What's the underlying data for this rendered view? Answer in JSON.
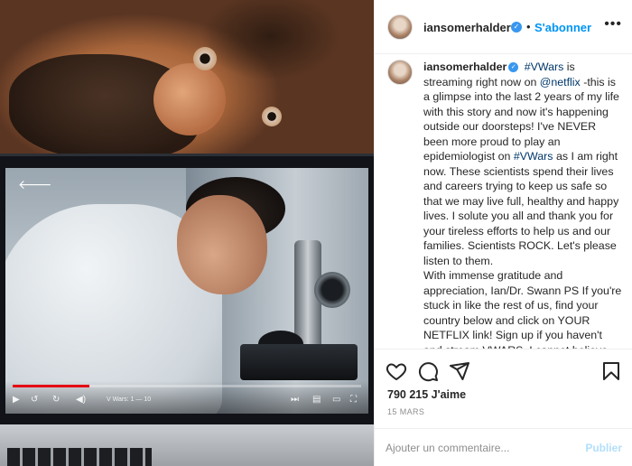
{
  "post": {
    "username": "iansomerhalder",
    "follow_label": "S'abonner",
    "separator": "•",
    "more_label": "•••",
    "verified_mark": "✓"
  },
  "caption": {
    "username": "iansomerhalder",
    "parts": [
      {
        "text": "#VWars",
        "link": true
      },
      {
        "text": " is streaming right now on ",
        "link": false
      },
      {
        "text": "@netflix",
        "link": true
      },
      {
        "text": " -this is a glimpse into the last 2 years of my life with this story and now it's happening outside our doorsteps! I've NEVER been more proud to play an epidemiologist on ",
        "link": false
      },
      {
        "text": "#VWars",
        "link": true
      },
      {
        "text": " as I am right now. These scientists spend their lives and careers trying to keep us safe so that we may live full, healthy and happy lives. I solute you all and thank you for your tireless efforts to help us and our families. Scientists ROCK. Let's please listen to them.",
        "link": false
      }
    ],
    "continuation": "With immense gratitude and appreciation, Ian/Dr. Swann PS If you're stuck in like the rest of us, find your country below and click on YOUR NETFLIX link! Sign up if you haven't and stream VWARS. I cannot believe this is happening to the world! I spent"
  },
  "stats": {
    "likes": "790 215 J'aime",
    "date": "15 MARS"
  },
  "comment": {
    "placeholder": "Ajouter un commentaire...",
    "publish_label": "Publier"
  },
  "video": {
    "title": "V Wars: 1 — 10",
    "progress": 0.22,
    "back_arrow": "🡐"
  },
  "icons": {
    "like": "heart-icon",
    "comment": "comment-icon",
    "share": "send-icon",
    "save": "bookmark-icon"
  },
  "colors": {
    "accent": "#0095f6",
    "verified": "#3897f0",
    "link": "#00376b",
    "netflix_red": "#e50914"
  }
}
